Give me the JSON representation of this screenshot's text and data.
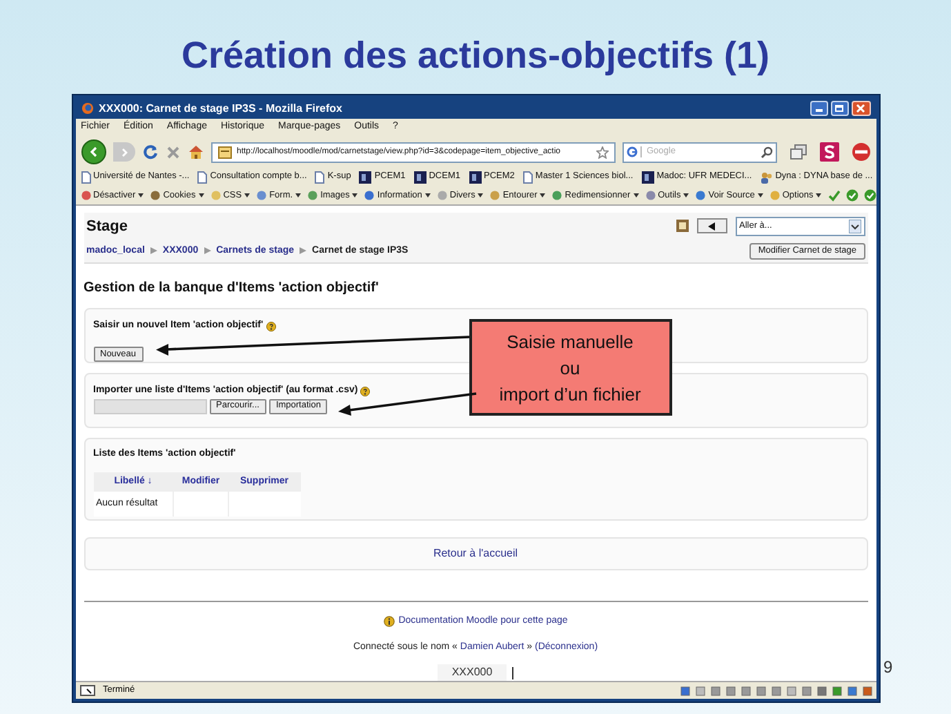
{
  "slide_title": "Création des actions-objectifs (1)",
  "slide_number": "9",
  "browser": {
    "title": "XXX000: Carnet de stage IP3S - Mozilla Firefox",
    "menu": [
      "Fichier",
      "Édition",
      "Affichage",
      "Historique",
      "Marque-pages",
      "Outils",
      "?"
    ],
    "url": "http://localhost/moodle/mod/carnetstage/view.php?id=3&codepage=item_objective_actio",
    "search_placeholder": "Google",
    "bookmarks": [
      {
        "label": "Université de Nantes -...",
        "kind": "page"
      },
      {
        "label": "Consultation compte b...",
        "kind": "page"
      },
      {
        "label": "K-sup",
        "kind": "page"
      },
      {
        "label": "PCEM1",
        "kind": "site"
      },
      {
        "label": "DCEM1",
        "kind": "site"
      },
      {
        "label": "PCEM2",
        "kind": "site"
      },
      {
        "label": "Master 1 Sciences biol...",
        "kind": "page"
      },
      {
        "label": "Madoc: UFR MEDECI...",
        "kind": "site"
      },
      {
        "label": "Dyna : DYNA base de ...",
        "kind": "people"
      }
    ],
    "dev_toolbar": [
      "Désactiver",
      "Cookies",
      "CSS",
      "Form.",
      "Images",
      "Information",
      "Divers",
      "Entourer",
      "Redimensionner",
      "Outils",
      "Voir Source",
      "Options"
    ],
    "status": "Terminé"
  },
  "page": {
    "header": "Stage",
    "jump_menu": "Aller à...",
    "breadcrumbs": [
      {
        "label": "madoc_local",
        "link": true
      },
      {
        "label": "XXX000",
        "link": true
      },
      {
        "label": "Carnets de stage",
        "link": true
      },
      {
        "label": "Carnet de stage IP3S",
        "link": false
      }
    ],
    "edit_button": "Modifier Carnet de stage",
    "heading": "Gestion de la banque d'Items 'action objectif'",
    "new_section": {
      "title": "Saisir un nouvel Item 'action objectif'",
      "button": "Nouveau"
    },
    "import_section": {
      "title": "Importer une liste d'Items 'action objectif' (au format .csv)",
      "browse_button": "Parcourir...",
      "import_button": "Importation"
    },
    "list_section": {
      "title": "Liste des Items 'action objectif'",
      "columns": [
        "Libellé ↓",
        "Modifier",
        "Supprimer"
      ],
      "empty_text": "Aucun résultat"
    },
    "home_link": "Retour à l'accueil",
    "doc_link": "Documentation Moodle pour cette page",
    "login": {
      "prefix": "Connecté sous le nom «",
      "user": "Damien Aubert",
      "middle": "»",
      "logout": "(Déconnexion)"
    },
    "course_box": "XXX000"
  },
  "callout": [
    "Saisie manuelle",
    "ou",
    "import d’un fichier"
  ]
}
